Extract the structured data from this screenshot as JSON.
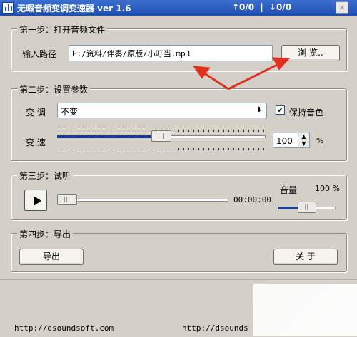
{
  "window": {
    "title": "无暇音频变调变速器 ver 1.6",
    "counter": {
      "up": "↑0/0",
      "sep": "|",
      "down": "↓0/0"
    },
    "close_label": "×"
  },
  "step1": {
    "title": "第一步：打开音频文件",
    "path_label": "输入路径",
    "path_value": "E:/资料/伴奏/原版/小叮当.mp3",
    "browse_label": "浏 览.."
  },
  "step2": {
    "title": "第二步：设置参数",
    "pitch_label": "变 调",
    "pitch_value": "不变",
    "keep_tone_label": "保持音色",
    "keep_tone_checked": true,
    "speed_label": "变 速",
    "speed_value": "100",
    "speed_unit": "%",
    "speed_slider_fraction": 0.5
  },
  "step3": {
    "title": "第三步：试听",
    "time": "00:00:00",
    "volume_label": "音量",
    "volume_value": "100 %",
    "progress_fraction": 0.0,
    "volume_fraction": 0.5
  },
  "step4": {
    "title": "第四步：导出",
    "export_label": "导出",
    "about_label": "关 于"
  },
  "footer": {
    "url_left": "http://dsoundsoft.com",
    "url_right": "http://dsounds"
  },
  "colors": {
    "titlebar": "#1c4fb4",
    "annotation_arrow": "#e03020",
    "slider_fill": "#1c3f8a"
  }
}
